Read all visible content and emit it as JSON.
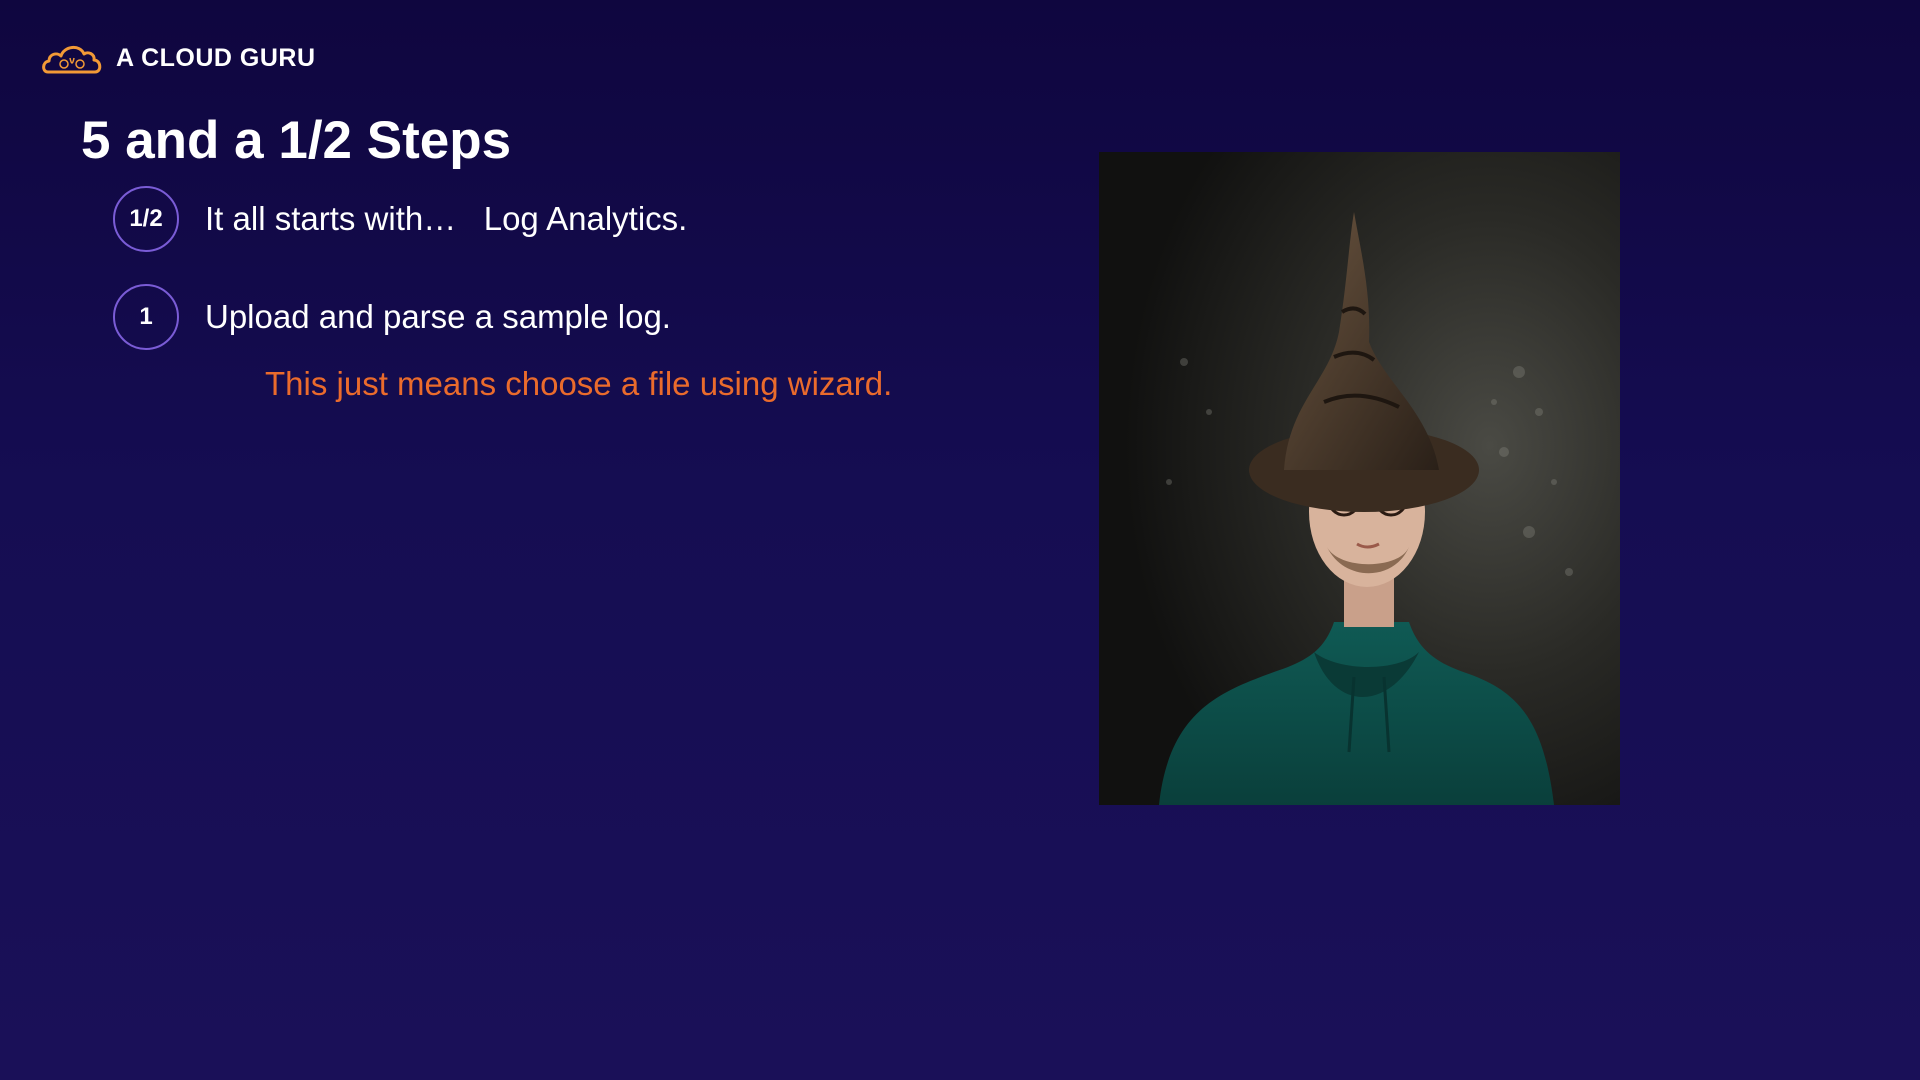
{
  "brand": {
    "name": "A CLOUD GURU",
    "logo_icon": "cloud-logo-icon",
    "accent": "#f29a36"
  },
  "slide": {
    "title": "5 and a 1/2 Steps",
    "steps": [
      {
        "badge": "1/2",
        "text": "It all starts with…   Log Analytics."
      },
      {
        "badge": "1",
        "text": "Upload and parse a sample log."
      }
    ],
    "note": "This just means choose a file using wizard.",
    "note_color": "#ea6b2c"
  },
  "photo": {
    "subject": "person-in-wizard-hat-photo"
  }
}
